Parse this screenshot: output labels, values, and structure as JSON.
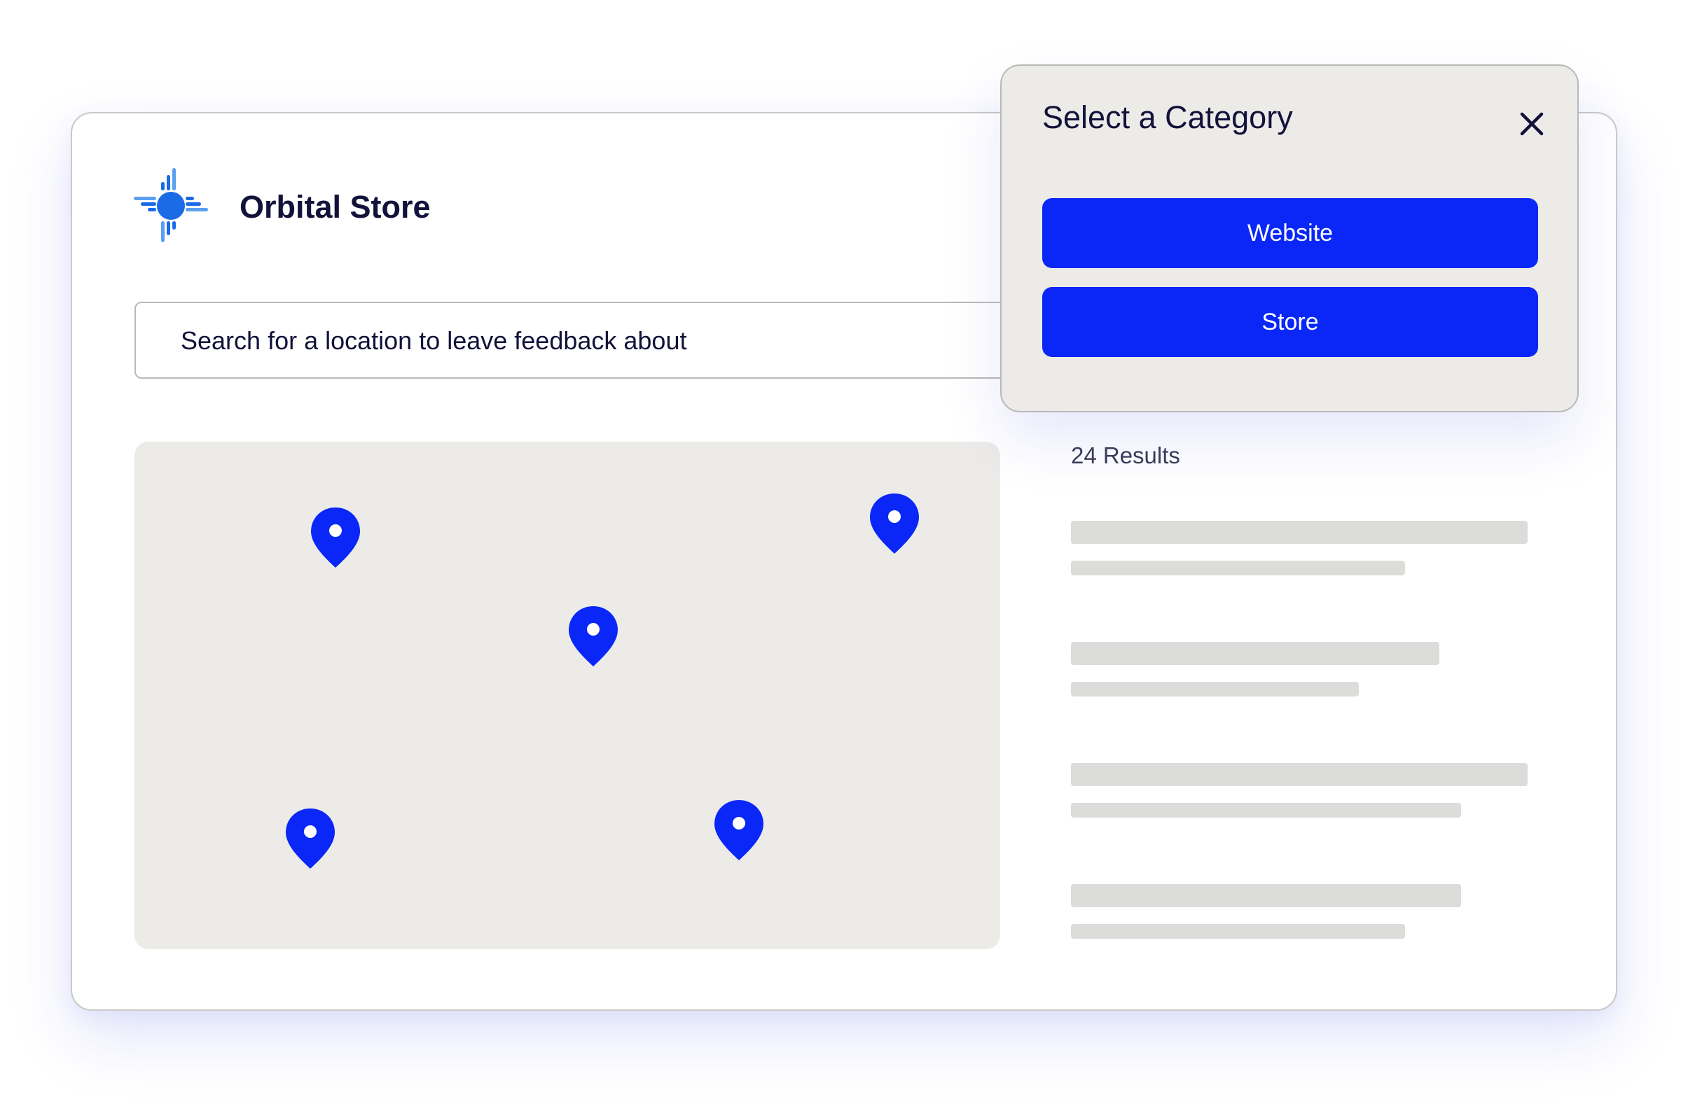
{
  "app": {
    "brand_name": "Orbital Store",
    "logo_icon": "orbital-sun-logo"
  },
  "search": {
    "text": "Search for a location to leave feedback about"
  },
  "map": {
    "pin_count": 5,
    "pin_color": "#0a27f7",
    "background_color": "#ecebe8"
  },
  "results": {
    "count_label": "24 Results",
    "placeholder_items": 4
  },
  "category_popover": {
    "title": "Select a Category",
    "close_icon": "close-icon",
    "options": [
      {
        "label": "Website"
      },
      {
        "label": "Store"
      }
    ]
  },
  "colors": {
    "accent": "#0a27f7",
    "text_dark": "#12123a",
    "logo_blue": "#1a6be6",
    "logo_light_blue": "#5aa0f0"
  }
}
